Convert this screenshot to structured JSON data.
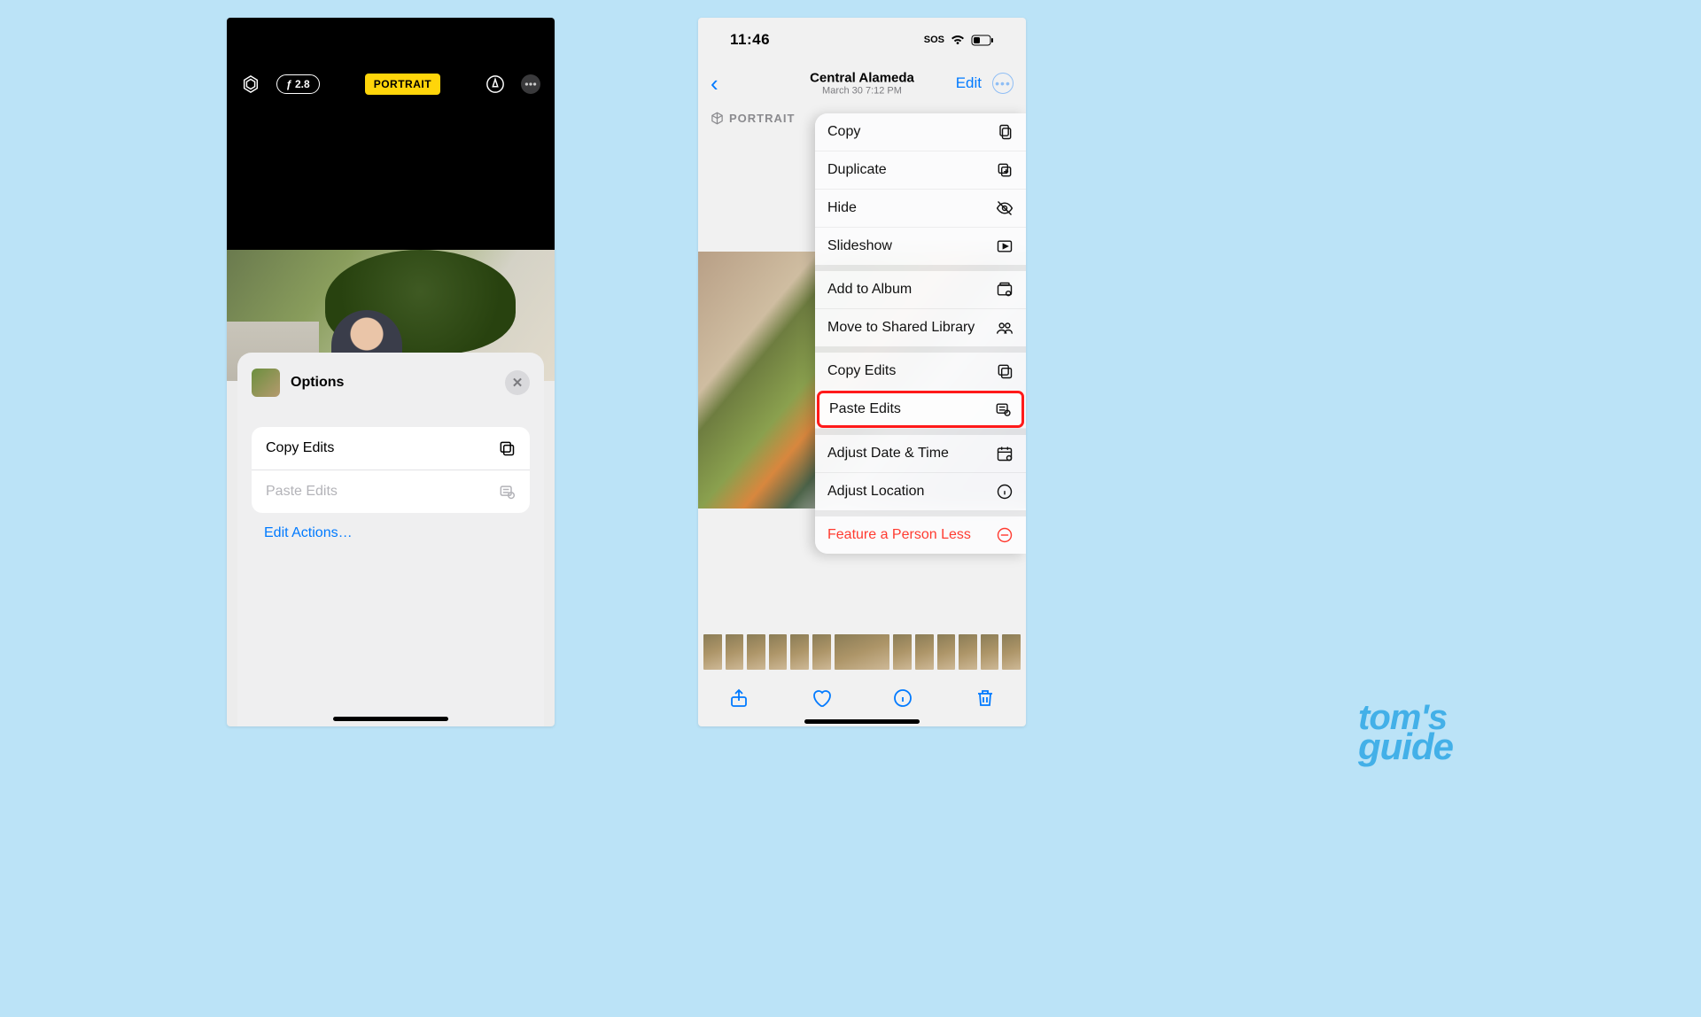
{
  "leftPhone": {
    "toolbar": {
      "fstop": "ƒ 2.8",
      "mode": "PORTRAIT"
    },
    "sheet": {
      "title": "Options",
      "rows": [
        {
          "label": "Copy Edits",
          "enabled": true
        },
        {
          "label": "Paste Edits",
          "enabled": false
        }
      ],
      "editActions": "Edit Actions…"
    }
  },
  "rightPhone": {
    "status": {
      "time": "11:46",
      "sos": "SOS"
    },
    "nav": {
      "title": "Central Alameda",
      "subtitle": "March 30  7:12 PM",
      "edit": "Edit"
    },
    "portraitLabel": "PORTRAIT",
    "menu": {
      "group1": [
        "Copy",
        "Duplicate",
        "Hide",
        "Slideshow"
      ],
      "group2": [
        "Add to Album",
        "Move to Shared Library"
      ],
      "group3": [
        "Copy Edits",
        "Paste Edits"
      ],
      "group4": [
        "Adjust Date & Time",
        "Adjust Location"
      ],
      "destructive": "Feature a Person Less",
      "highlighted": "Paste Edits"
    }
  },
  "watermark": {
    "line1": "tom's",
    "line2": "guide"
  }
}
